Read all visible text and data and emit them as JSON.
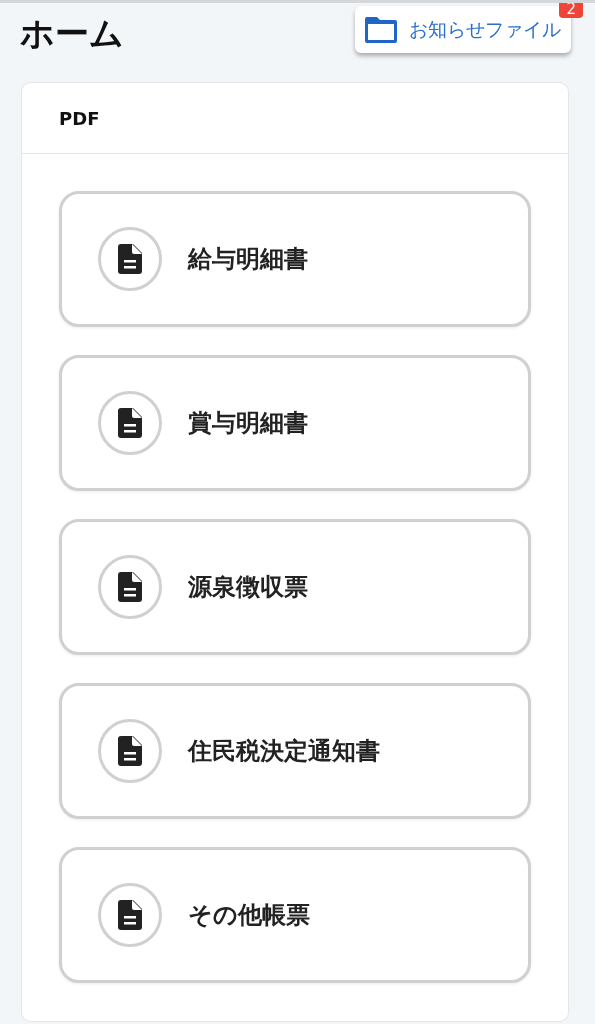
{
  "title": "ホーム",
  "notice_button": {
    "label": "お知らせファイル",
    "badge": "2"
  },
  "card": {
    "header": "PDF",
    "items": [
      {
        "label": "給与明細書"
      },
      {
        "label": "賞与明細書"
      },
      {
        "label": "源泉徴収票"
      },
      {
        "label": "住民税決定通知書"
      },
      {
        "label": "その他帳票"
      }
    ]
  }
}
